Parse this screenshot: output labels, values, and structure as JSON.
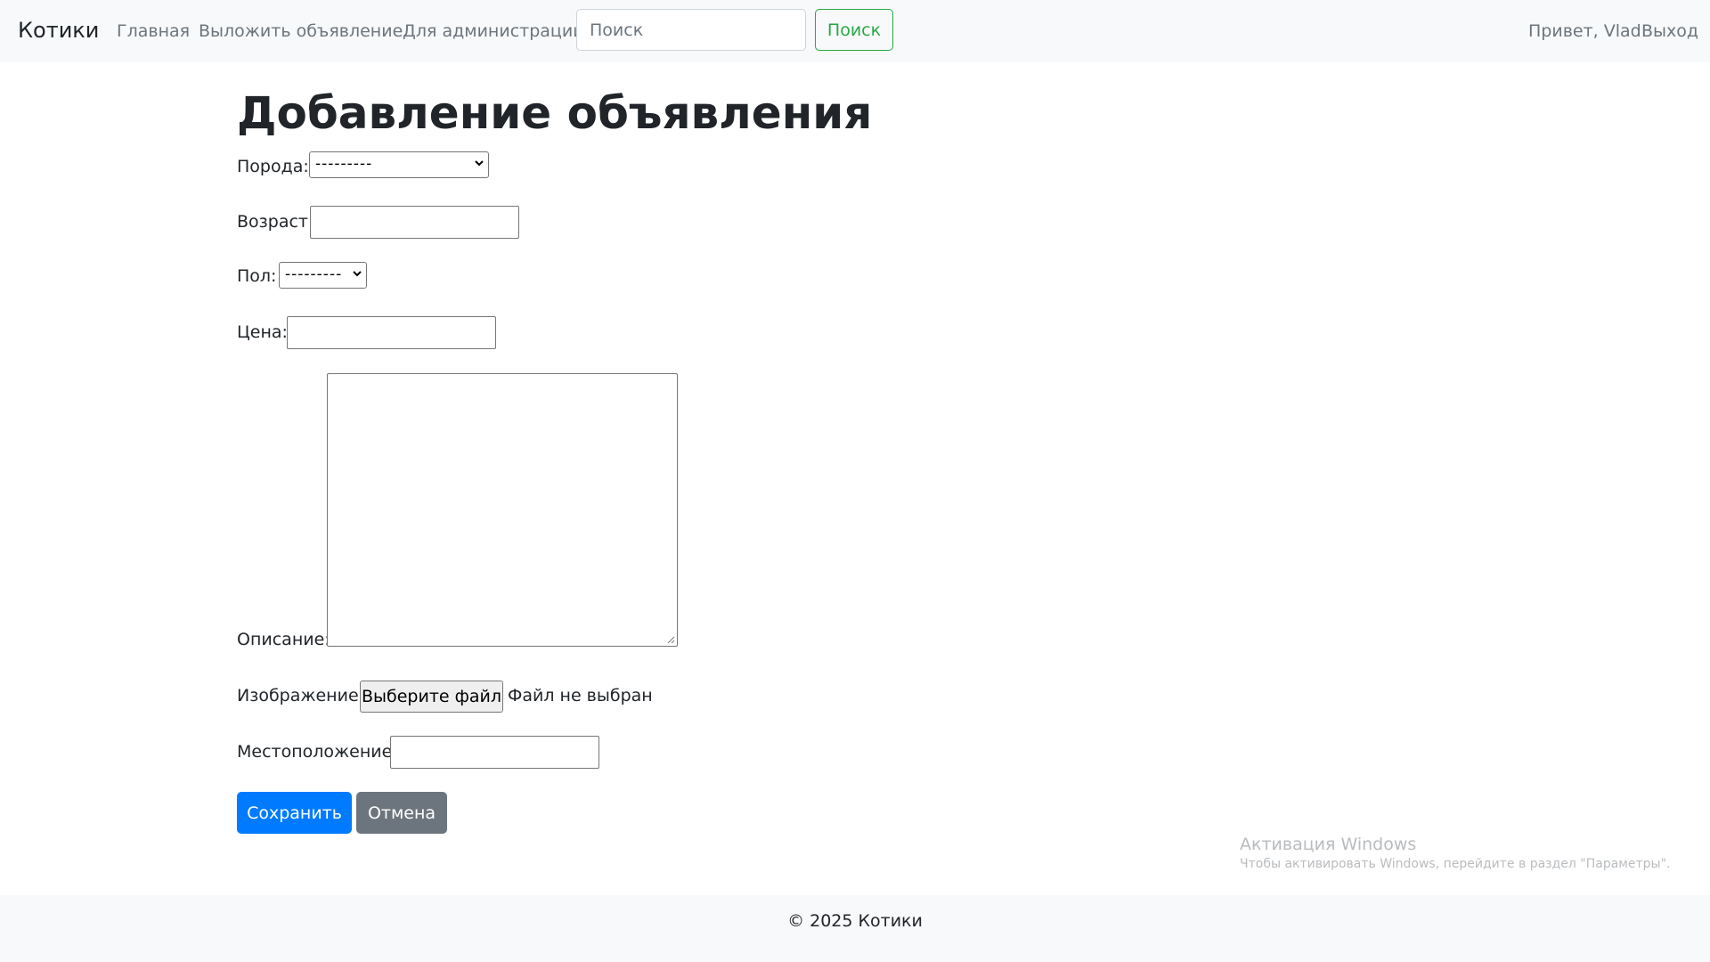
{
  "navbar": {
    "brand": "Котики",
    "links": [
      "Главная",
      "Выложить объявление",
      "Для администрации"
    ],
    "search_placeholder": "Поиск",
    "search_button": "Поиск",
    "greeting": "Привет, Vlad",
    "logout": "Выход"
  },
  "form": {
    "title": "Добавление объявления",
    "breed": {
      "label": "Порода:",
      "selected": "---------"
    },
    "age": {
      "label": "Возраст:",
      "value": ""
    },
    "gender": {
      "label": "Пол:",
      "selected": "---------"
    },
    "price": {
      "label": "Цена:",
      "value": ""
    },
    "description": {
      "label": "Описание:",
      "value": ""
    },
    "image": {
      "label": "Изображение:",
      "button": "Выберите файл",
      "status": "Файл не выбран"
    },
    "location": {
      "label": "Местоположение:",
      "value": ""
    },
    "save_button": "Сохранить",
    "cancel_button": "Отмена"
  },
  "watermark": {
    "title": "Активация Windows",
    "subtitle": "Чтобы активировать Windows, перейдите в раздел \"Параметры\"."
  },
  "footer": {
    "text": "© 2025 Котики"
  },
  "colors": {
    "navbar_bg": "#f8f9fa",
    "primary": "#007bff",
    "secondary": "#6c757d",
    "success": "#28a745"
  }
}
